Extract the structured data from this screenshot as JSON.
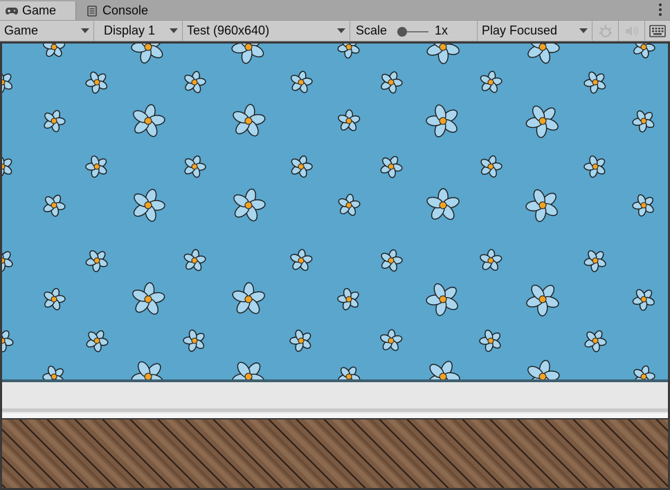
{
  "tabs": [
    {
      "label": "Game",
      "icon": "gamepad-icon",
      "active": true
    },
    {
      "label": "Console",
      "icon": "console-icon",
      "active": false
    }
  ],
  "toolbar": {
    "view_mode": "Game",
    "display": "Display 1",
    "resolution": "Test (960x640)",
    "scale_label": "Scale",
    "scale_value": "1x",
    "play_mode": "Play Focused",
    "icons": [
      "stats-icon",
      "audio-mute-icon",
      "keyboard-icon"
    ]
  },
  "colors": {
    "wallpaper": "#5aa6cd",
    "petal": "#a9d6ee",
    "flower_center": "#f2a324",
    "skirting": "#e7e7e7",
    "floor": "#7a5a42"
  }
}
